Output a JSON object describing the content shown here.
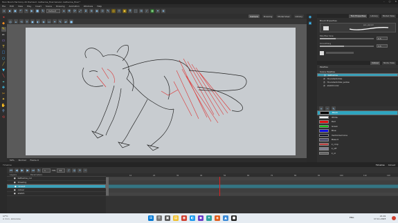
{
  "window": {
    "title": "Toon Boom Harmony 20 Premium: katherine_final Version: katherine_final *"
  },
  "menu": [
    "File",
    "Edit",
    "View",
    "Play",
    "Insert",
    "Scene",
    "Drawing",
    "Animation",
    "Windows",
    "Help"
  ],
  "toolbar": {
    "mode_select": "Default"
  },
  "view_tabs": [
    "Camera",
    "Drawing",
    "Model View",
    "Library"
  ],
  "viewport_status": {
    "zoom": "50%",
    "mode": "Normal",
    "frame": "Frame 0"
  },
  "right_panel": {
    "tabs": [
      "Tool Properties",
      "Library",
      "Model View"
    ],
    "tool_properties_title": "Brush Properties",
    "brush_label": "pen_wacom",
    "min_max": "Min/Max Size",
    "smoothing": "Smoothing",
    "size_val": "0.5",
    "smooth_val": "3.5",
    "palette_tabs": [
      "Colour",
      "Node View"
    ],
    "palette_header": "Palettes",
    "palette_section": "Scene Palettes",
    "palettes": [
      "katherine",
      "Houndedinhka",
      "Houndedinhka yellow",
      "sketchcolor"
    ],
    "swatches": [
      {
        "name": "Black",
        "color": "#000000"
      },
      {
        "name": "White",
        "color": "#ffffff"
      },
      {
        "name": "Red",
        "color": "#e01010"
      },
      {
        "name": "Green",
        "color": "#10c010"
      },
      {
        "name": "Blue",
        "color": "#1010e0"
      },
      {
        "name": "Vectorized Line",
        "color": "#101030"
      },
      {
        "name": "Base 0",
        "color": "#505070"
      },
      {
        "name": "k_crnp",
        "color": "#c04040"
      },
      {
        "name": "k_off",
        "color": "#808090"
      },
      {
        "name": "k_ol",
        "color": "#606060"
      }
    ]
  },
  "timeline": {
    "header_left": "Timeline",
    "header_right": "Timeline",
    "header_xsheet": "Xsheet",
    "frame_field": "1",
    "fps_label": "FPS",
    "end_field": "24",
    "layers_col_header": "Layers",
    "params_header": "Parameters",
    "layers": [
      {
        "name": "katherine_col"
      },
      {
        "name": "Drawing"
      },
      {
        "name": "lineart"
      },
      {
        "name": "colour"
      },
      {
        "name": "sketch"
      }
    ],
    "frame_numbers": [
      "10",
      "20",
      "30",
      "40",
      "50",
      "60",
      "70",
      "80",
      "90",
      "100",
      "110",
      "120"
    ]
  },
  "taskbar": {
    "weather_temp": "17°C",
    "weather_desc": "A mon. akkerelse",
    "time": "21:01",
    "date": "17-11-2023",
    "lang": "ENG",
    "colors": {
      "windows": "#0078d4",
      "explorer": "#f0c030",
      "chrome": "#d04030",
      "edge": "#1f9cf0",
      "toonboom": "#2ba3a0"
    }
  },
  "accent": "#3aa0b8",
  "sketch_colors": {
    "line": "#222222",
    "shadow": "#e02020"
  }
}
